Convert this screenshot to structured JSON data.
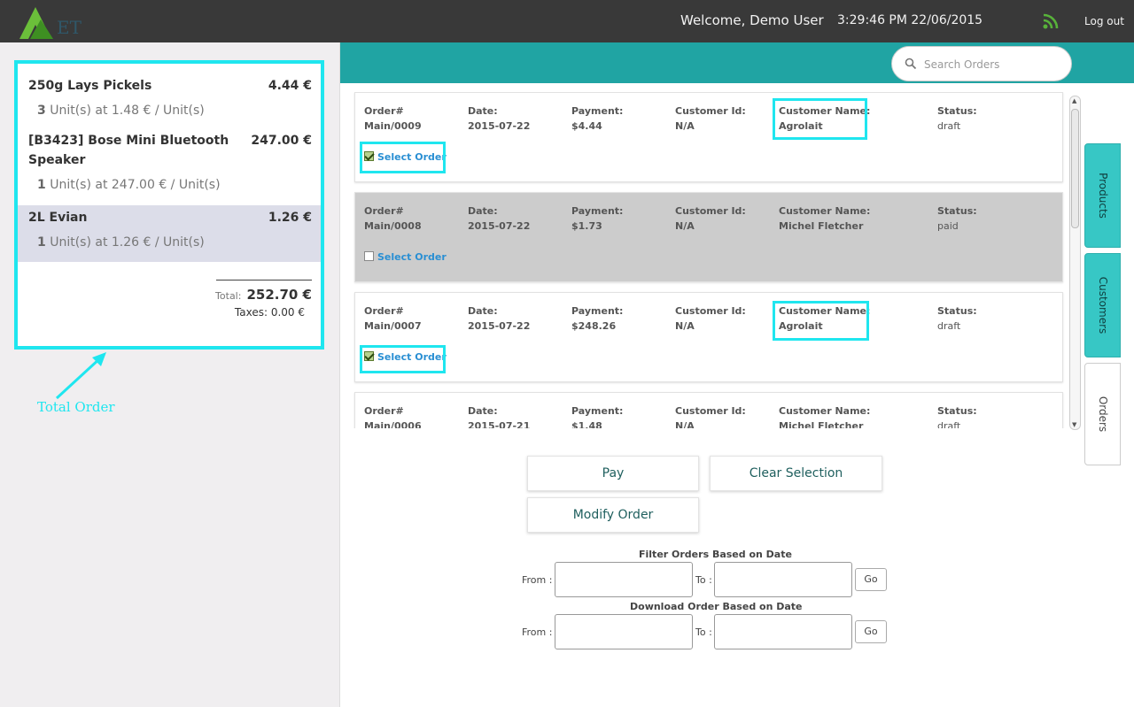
{
  "header": {
    "welcome": "Welcome, Demo User",
    "clock": "3:29:46 PM 22/06/2015",
    "logout": "Log out",
    "rss_icon": "rss-icon",
    "logo": "logo"
  },
  "receipt": {
    "lines": [
      {
        "name": "250g Lays Pickels",
        "price": "4.44 €",
        "qty": "3",
        "unit": " Unit(s) at 1.48 € / Unit(s)"
      },
      {
        "name": "[B3423] Bose Mini Bluetooth Speaker",
        "price": "247.00 €",
        "qty": "1",
        "unit": " Unit(s) at 247.00 € / Unit(s)"
      },
      {
        "name": "2L Evian",
        "price": "1.26 €",
        "qty": "1",
        "unit": " Unit(s) at 1.26 € / Unit(s)"
      }
    ],
    "total_label": "Total:",
    "total_value": "252.70 €",
    "taxes": "Taxes: 0.00 €"
  },
  "annotation": {
    "text": "Total Order"
  },
  "search": {
    "placeholder": "Search Orders"
  },
  "labels": {
    "order": "Order#",
    "date": "Date:",
    "payment": "Payment:",
    "customer_id": "Customer Id:",
    "customer_name": "Customer Name:",
    "status": "Status:",
    "select_order": "Select Order"
  },
  "orders": [
    {
      "order": "Main/0009",
      "date": "2015-07-22",
      "payment": "$4.44",
      "customer_id": "N/A",
      "customer_name": "Agrolait",
      "status": "draft",
      "selected": true
    },
    {
      "order": "Main/0008",
      "date": "2015-07-22",
      "payment": "$1.73",
      "customer_id": "N/A",
      "customer_name": "Michel Fletcher",
      "status": "paid",
      "selected": false
    },
    {
      "order": "Main/0007",
      "date": "2015-07-22",
      "payment": "$248.26",
      "customer_id": "N/A",
      "customer_name": "Agrolait",
      "status": "draft",
      "selected": true
    },
    {
      "order": "Main/0006",
      "date": "2015-07-21",
      "payment": "$1.48",
      "customer_id": "N/A",
      "customer_name": "Michel Fletcher",
      "status": "draft",
      "selected": false
    }
  ],
  "tabs": {
    "products": "Products",
    "customers": "Customers",
    "orders": "Orders"
  },
  "buttons": {
    "pay": "Pay",
    "clear": "Clear Selection",
    "modify": "Modify Order"
  },
  "filter": {
    "title": "Filter Orders Based on Date",
    "from": "From :",
    "to": "To :",
    "go": "Go"
  },
  "download": {
    "title": "Download Order Based on Date",
    "from": "From :",
    "to": "To :",
    "go": "Go"
  },
  "colors": {
    "accent": "#1fe6ef",
    "teal": "#20a4a3",
    "topbar": "#393939"
  }
}
